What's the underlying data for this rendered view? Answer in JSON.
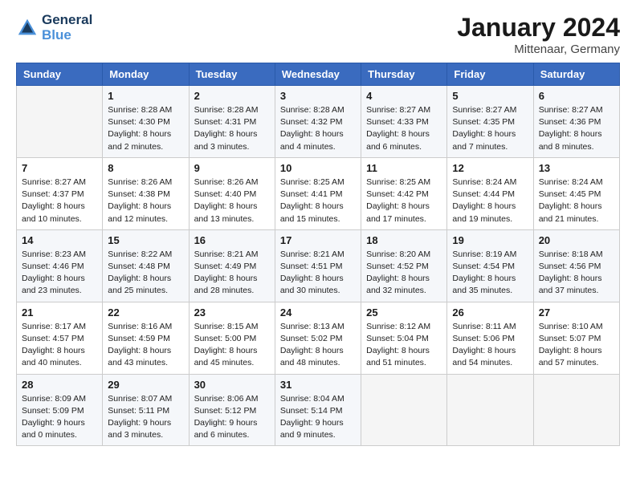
{
  "header": {
    "logo_line1": "General",
    "logo_line2": "Blue",
    "month_title": "January 2024",
    "location": "Mittenaar, Germany"
  },
  "days_of_week": [
    "Sunday",
    "Monday",
    "Tuesday",
    "Wednesday",
    "Thursday",
    "Friday",
    "Saturday"
  ],
  "weeks": [
    [
      {
        "day": "",
        "info": ""
      },
      {
        "day": "1",
        "info": "Sunrise: 8:28 AM\nSunset: 4:30 PM\nDaylight: 8 hours\nand 2 minutes."
      },
      {
        "day": "2",
        "info": "Sunrise: 8:28 AM\nSunset: 4:31 PM\nDaylight: 8 hours\nand 3 minutes."
      },
      {
        "day": "3",
        "info": "Sunrise: 8:28 AM\nSunset: 4:32 PM\nDaylight: 8 hours\nand 4 minutes."
      },
      {
        "day": "4",
        "info": "Sunrise: 8:27 AM\nSunset: 4:33 PM\nDaylight: 8 hours\nand 6 minutes."
      },
      {
        "day": "5",
        "info": "Sunrise: 8:27 AM\nSunset: 4:35 PM\nDaylight: 8 hours\nand 7 minutes."
      },
      {
        "day": "6",
        "info": "Sunrise: 8:27 AM\nSunset: 4:36 PM\nDaylight: 8 hours\nand 8 minutes."
      }
    ],
    [
      {
        "day": "7",
        "info": "Sunrise: 8:27 AM\nSunset: 4:37 PM\nDaylight: 8 hours\nand 10 minutes."
      },
      {
        "day": "8",
        "info": "Sunrise: 8:26 AM\nSunset: 4:38 PM\nDaylight: 8 hours\nand 12 minutes."
      },
      {
        "day": "9",
        "info": "Sunrise: 8:26 AM\nSunset: 4:40 PM\nDaylight: 8 hours\nand 13 minutes."
      },
      {
        "day": "10",
        "info": "Sunrise: 8:25 AM\nSunset: 4:41 PM\nDaylight: 8 hours\nand 15 minutes."
      },
      {
        "day": "11",
        "info": "Sunrise: 8:25 AM\nSunset: 4:42 PM\nDaylight: 8 hours\nand 17 minutes."
      },
      {
        "day": "12",
        "info": "Sunrise: 8:24 AM\nSunset: 4:44 PM\nDaylight: 8 hours\nand 19 minutes."
      },
      {
        "day": "13",
        "info": "Sunrise: 8:24 AM\nSunset: 4:45 PM\nDaylight: 8 hours\nand 21 minutes."
      }
    ],
    [
      {
        "day": "14",
        "info": "Sunrise: 8:23 AM\nSunset: 4:46 PM\nDaylight: 8 hours\nand 23 minutes."
      },
      {
        "day": "15",
        "info": "Sunrise: 8:22 AM\nSunset: 4:48 PM\nDaylight: 8 hours\nand 25 minutes."
      },
      {
        "day": "16",
        "info": "Sunrise: 8:21 AM\nSunset: 4:49 PM\nDaylight: 8 hours\nand 28 minutes."
      },
      {
        "day": "17",
        "info": "Sunrise: 8:21 AM\nSunset: 4:51 PM\nDaylight: 8 hours\nand 30 minutes."
      },
      {
        "day": "18",
        "info": "Sunrise: 8:20 AM\nSunset: 4:52 PM\nDaylight: 8 hours\nand 32 minutes."
      },
      {
        "day": "19",
        "info": "Sunrise: 8:19 AM\nSunset: 4:54 PM\nDaylight: 8 hours\nand 35 minutes."
      },
      {
        "day": "20",
        "info": "Sunrise: 8:18 AM\nSunset: 4:56 PM\nDaylight: 8 hours\nand 37 minutes."
      }
    ],
    [
      {
        "day": "21",
        "info": "Sunrise: 8:17 AM\nSunset: 4:57 PM\nDaylight: 8 hours\nand 40 minutes."
      },
      {
        "day": "22",
        "info": "Sunrise: 8:16 AM\nSunset: 4:59 PM\nDaylight: 8 hours\nand 43 minutes."
      },
      {
        "day": "23",
        "info": "Sunrise: 8:15 AM\nSunset: 5:00 PM\nDaylight: 8 hours\nand 45 minutes."
      },
      {
        "day": "24",
        "info": "Sunrise: 8:13 AM\nSunset: 5:02 PM\nDaylight: 8 hours\nand 48 minutes."
      },
      {
        "day": "25",
        "info": "Sunrise: 8:12 AM\nSunset: 5:04 PM\nDaylight: 8 hours\nand 51 minutes."
      },
      {
        "day": "26",
        "info": "Sunrise: 8:11 AM\nSunset: 5:06 PM\nDaylight: 8 hours\nand 54 minutes."
      },
      {
        "day": "27",
        "info": "Sunrise: 8:10 AM\nSunset: 5:07 PM\nDaylight: 8 hours\nand 57 minutes."
      }
    ],
    [
      {
        "day": "28",
        "info": "Sunrise: 8:09 AM\nSunset: 5:09 PM\nDaylight: 9 hours\nand 0 minutes."
      },
      {
        "day": "29",
        "info": "Sunrise: 8:07 AM\nSunset: 5:11 PM\nDaylight: 9 hours\nand 3 minutes."
      },
      {
        "day": "30",
        "info": "Sunrise: 8:06 AM\nSunset: 5:12 PM\nDaylight: 9 hours\nand 6 minutes."
      },
      {
        "day": "31",
        "info": "Sunrise: 8:04 AM\nSunset: 5:14 PM\nDaylight: 9 hours\nand 9 minutes."
      },
      {
        "day": "",
        "info": ""
      },
      {
        "day": "",
        "info": ""
      },
      {
        "day": "",
        "info": ""
      }
    ]
  ]
}
